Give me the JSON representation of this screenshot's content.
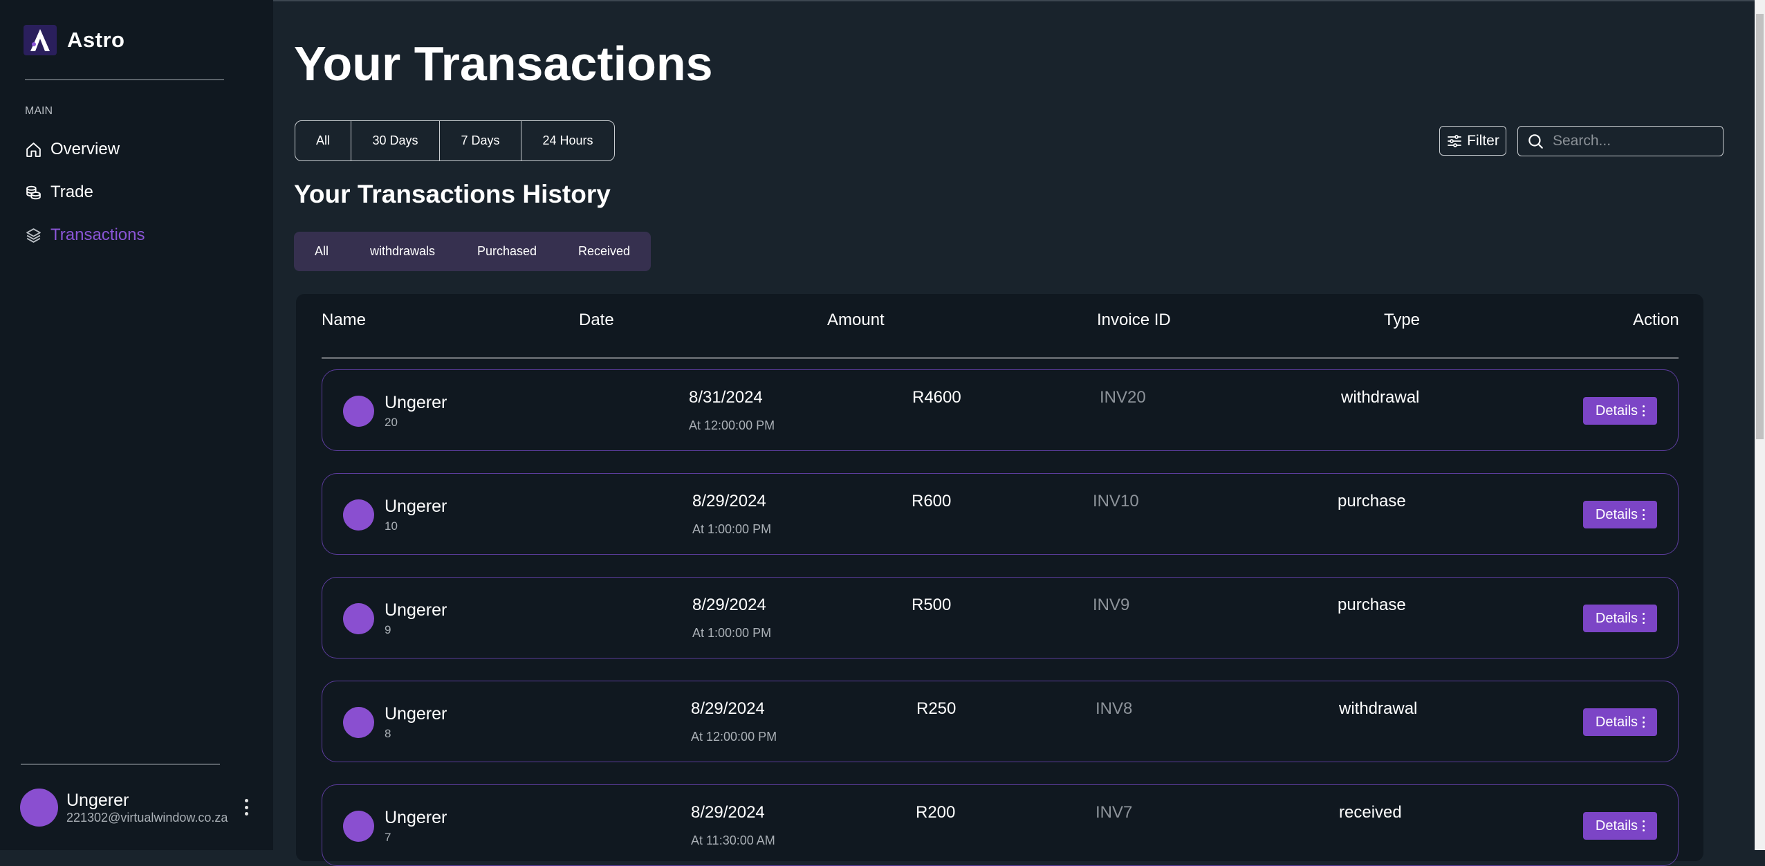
{
  "sidebar": {
    "brand": "Astro",
    "section_label": "MAIN",
    "items": [
      {
        "label": "Overview",
        "icon": "home-icon"
      },
      {
        "label": "Trade",
        "icon": "coins-icon"
      },
      {
        "label": "Transactions",
        "icon": "layers-icon",
        "active": true
      }
    ],
    "user": {
      "name": "Ungerer",
      "email": "221302@virtualwindow.co.za"
    }
  },
  "header": {
    "title": "Your Transactions",
    "range_tabs": [
      "All",
      "30 Days",
      "7 Days",
      "24 Hours"
    ],
    "filter_label": "Filter",
    "search_placeholder": "Search..."
  },
  "history": {
    "title": "Your Transactions History",
    "type_tabs": [
      "All",
      "withdrawals",
      "Purchased",
      "Received"
    ]
  },
  "table": {
    "columns": [
      "Name",
      "Date",
      "Amount",
      "Invoice ID",
      "Type",
      "Action"
    ],
    "rows": [
      {
        "name": "Ungerer",
        "num": "20",
        "date": "8/31/2024",
        "time": "At 12:00:00 PM",
        "amount": "R4600",
        "invoice": "INV20",
        "type": "withdrawal",
        "action": "Details"
      },
      {
        "name": "Ungerer",
        "num": "10",
        "date": "8/29/2024",
        "time": "At 1:00:00 PM",
        "amount": "R600",
        "invoice": "INV10",
        "type": "purchase",
        "action": "Details"
      },
      {
        "name": "Ungerer",
        "num": "9",
        "date": "8/29/2024",
        "time": "At 1:00:00 PM",
        "amount": "R500",
        "invoice": "INV9",
        "type": "purchase",
        "action": "Details"
      },
      {
        "name": "Ungerer",
        "num": "8",
        "date": "8/29/2024",
        "time": "At 12:00:00 PM",
        "amount": "R250",
        "invoice": "INV8",
        "type": "withdrawal",
        "action": "Details"
      },
      {
        "name": "Ungerer",
        "num": "7",
        "date": "8/29/2024",
        "time": "At 11:30:00 AM",
        "amount": "R200",
        "invoice": "INV7",
        "type": "received",
        "action": "Details"
      }
    ]
  },
  "colors": {
    "accent": "#8a55d6",
    "button": "#7c45c6",
    "sidebar_bg": "#101820",
    "main_bg": "#19232c",
    "tab_group_bg": "#36304f"
  }
}
